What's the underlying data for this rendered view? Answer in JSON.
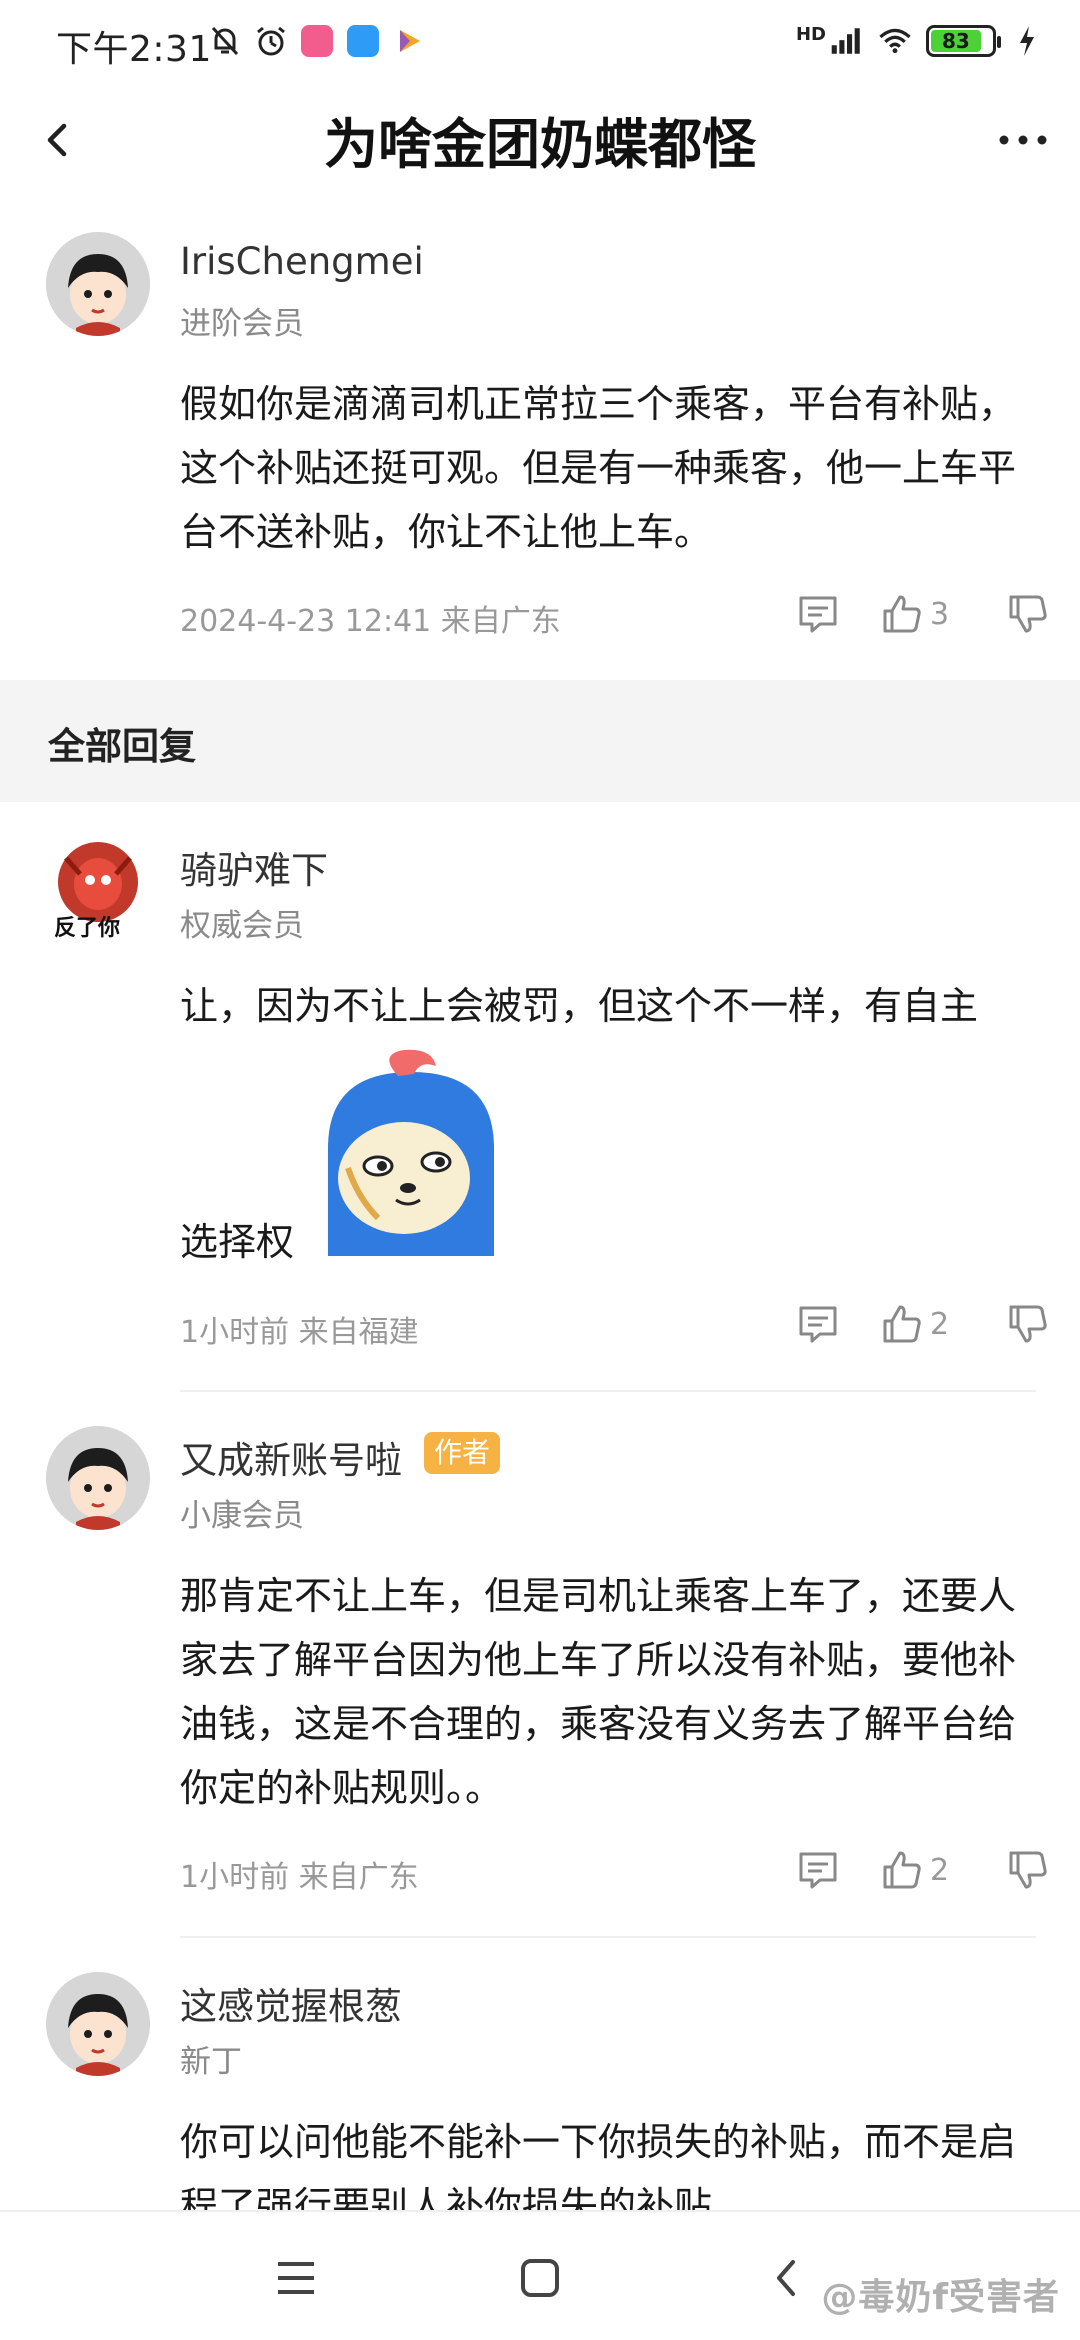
{
  "status_bar": {
    "time": "下午2:31",
    "network_label": "HD",
    "battery_level": "83",
    "battery_fraction": 0.83,
    "left_icons": [
      "mute-bell-icon",
      "alarm-icon",
      "bilibili-app-icon",
      "blue-app-icon",
      "play-app-icon"
    ],
    "right_icons": [
      "signal-icon",
      "wifi-icon",
      "battery-icon",
      "charging-icon"
    ],
    "app_colors": {
      "bilibili": "#f25d8e",
      "blue": "#2e9cf7",
      "play": "#f5a623"
    }
  },
  "header": {
    "title": "为啥金团奶蝶都怪",
    "back_icon": "chevron-left-icon",
    "more_icon": "more-dots-icon"
  },
  "main_post": {
    "user_name": "IrisChengmei",
    "user_level": "进阶会员",
    "content": "假如你是滴滴司机正常拉三个乘客，平台有补贴，这个补贴还挺可观。但是有一种乘客，他一上车平台不送补贴，你让不让他上车。",
    "meta": "2024-4-23 12:41  来自广东",
    "like_count": "3"
  },
  "section": {
    "title": "全部回复"
  },
  "replies": [
    {
      "user_name": "骑驴难下",
      "user_level": "权威会员",
      "avatar_text": "反了你",
      "content_line1": "让，因为不让上会被罚，但这个不一样，有自主",
      "content_line2": "选择权",
      "meta": "1小时前  来自福建",
      "like_count": "2"
    },
    {
      "user_name": "又成新账号啦",
      "author_badge": "作者",
      "user_level": "小康会员",
      "content": "那肯定不让上车，但是司机让乘客上车了，还要人家去了解平台因为他上车了所以没有补贴，要他补油钱，这是不合理的，乘客没有义务去了解平台给你定的补贴规则。。",
      "meta": "1小时前  来自广东",
      "like_count": "2"
    },
    {
      "user_name": "这感觉握根葱",
      "user_level": "新丁",
      "content": "你可以问他能不能补一下你损失的补贴，而不是启程了强行要别人补你损失的补贴"
    }
  ],
  "nav_bar": {
    "icons": [
      "menu-icon",
      "home-square-icon",
      "back-triangle-icon"
    ]
  },
  "watermark": "@毒奶f受害者"
}
